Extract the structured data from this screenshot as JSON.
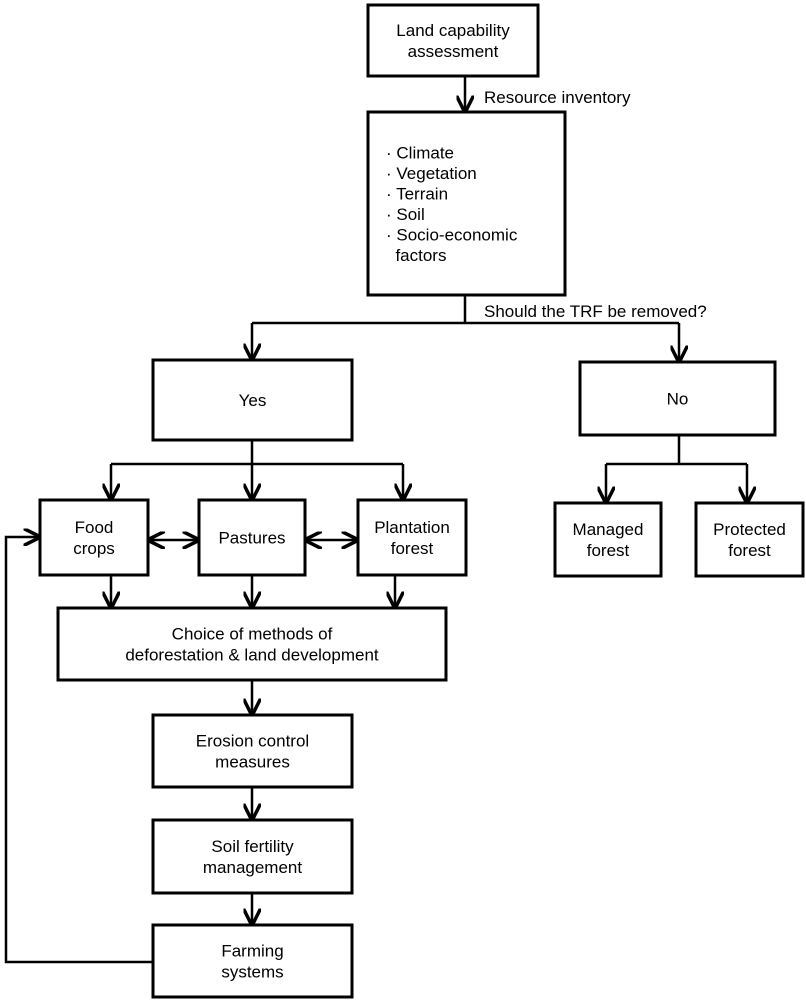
{
  "nodes": {
    "land_capability": [
      "Land capability",
      "assessment"
    ],
    "resources": [
      "· Climate",
      "· Vegetation",
      "· Terrain",
      "· Soil",
      "· Socio-economic",
      "  factors"
    ],
    "yes": [
      "Yes"
    ],
    "no": [
      "No"
    ],
    "managed_forest": [
      "Managed",
      "forest"
    ],
    "protected_forest": [
      "Protected",
      "forest"
    ],
    "food_crops": [
      "Food",
      "crops"
    ],
    "pastures": [
      "Pastures"
    ],
    "plantation_forest": [
      "Plantation",
      "forest"
    ],
    "choice_methods": [
      "Choice of methods of",
      "deforestation & land development"
    ],
    "erosion_control": [
      "Erosion control",
      "measures"
    ],
    "soil_fertility": [
      "Soil fertility",
      "management"
    ],
    "farming_systems": [
      "Farming",
      "systems"
    ]
  },
  "edge_labels": {
    "resource_inventory": "Resource inventory",
    "question": "Should the TRF be removed?"
  },
  "colors": {
    "stroke": "#000000",
    "background": "#ffffff"
  }
}
